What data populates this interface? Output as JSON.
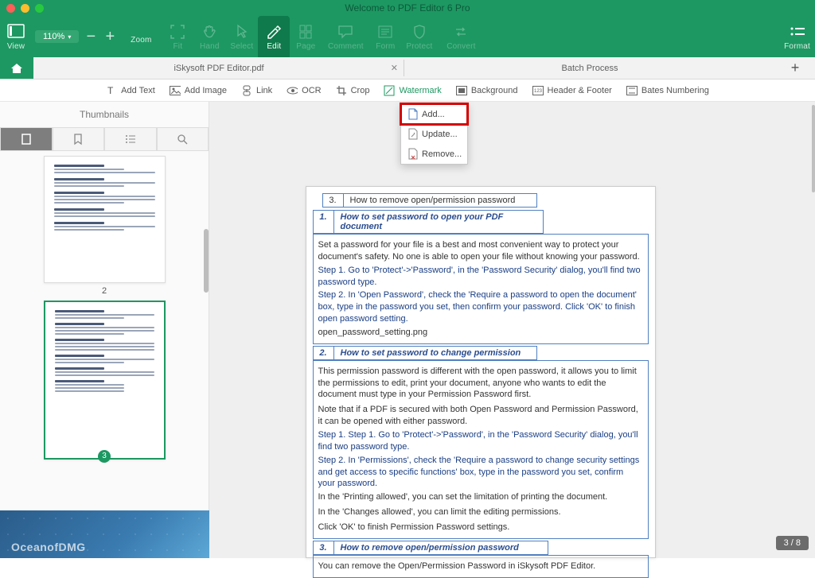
{
  "window": {
    "title": "Welcome to PDF Editor 6 Pro"
  },
  "zoom": {
    "value": "110%",
    "label": "Zoom"
  },
  "toolbar": {
    "view": "View",
    "fit": "Fit",
    "hand": "Hand",
    "select": "Select",
    "edit": "Edit",
    "page": "Page",
    "comment": "Comment",
    "form": "Form",
    "protect": "Protect",
    "convert": "Convert",
    "format": "Format"
  },
  "tabs": {
    "file": "iSkysoft PDF Editor.pdf",
    "batch": "Batch Process"
  },
  "sec": {
    "add_text": "Add Text",
    "add_image": "Add Image",
    "link": "Link",
    "ocr": "OCR",
    "crop": "Crop",
    "watermark": "Watermark",
    "background": "Background",
    "header_footer": "Header & Footer",
    "bates": "Bates Numbering"
  },
  "left": {
    "title": "Thumbnails",
    "page2": "2",
    "page3": "3"
  },
  "dropdown": {
    "add": "Add...",
    "update": "Update...",
    "remove": "Remove..."
  },
  "doc": {
    "toc_top_num": "3.",
    "toc_top": "How to remove open/permission password",
    "s1_num": "1.",
    "s1_title": "How to set password to open your PDF document",
    "s1_p1": "Set a password for your file is a best and most convenient way to protect your document's safety. No one is able to open your file without knowing your password.",
    "s1_step1": "Step 1. Go to 'Protect'->'Password', in the 'Password Security' dialog, you'll find two password type.",
    "s1_step2": "Step 2. In 'Open Password', check the 'Require a password to open the document' box, type in the password you set, then confirm your password. Click 'OK' to finish open password setting.",
    "s1_img": "open_password_setting.png",
    "s2_num": "2.",
    "s2_title": "How to set password to change permission",
    "s2_p1": "This permission password is different with the open password, it allows you to limit the permissions to edit, print your document, anyone who wants to edit the document must type in your Permission Password first.",
    "s2_p2": "Note that if a PDF is secured with both Open Password and Permission Password, it can be opened with either password.",
    "s2_step1": "Step 1. Step 1. Go to 'Protect'->'Password', in the 'Password Security' dialog, you'll find two password type.",
    "s2_step2": "Step 2. In 'Permissions', check the 'Require a password to change security settings and get access to specific functions' box, type in the password you set, confirm your password.",
    "s2_p3": "In the 'Printing allowed', you can set the limitation of printing the document.",
    "s2_p4": "In the 'Changes allowed', you can limit the editing permissions.",
    "s2_p5": "Click 'OK' to finish Permission Password settings.",
    "s3_num": "3.",
    "s3_title": "How to remove open/permission password",
    "s3_p1": "You can remove the Open/Permission Password in iSkysoft PDF Editor."
  },
  "counter": "3 / 8",
  "watermark": "OceanofDMG"
}
